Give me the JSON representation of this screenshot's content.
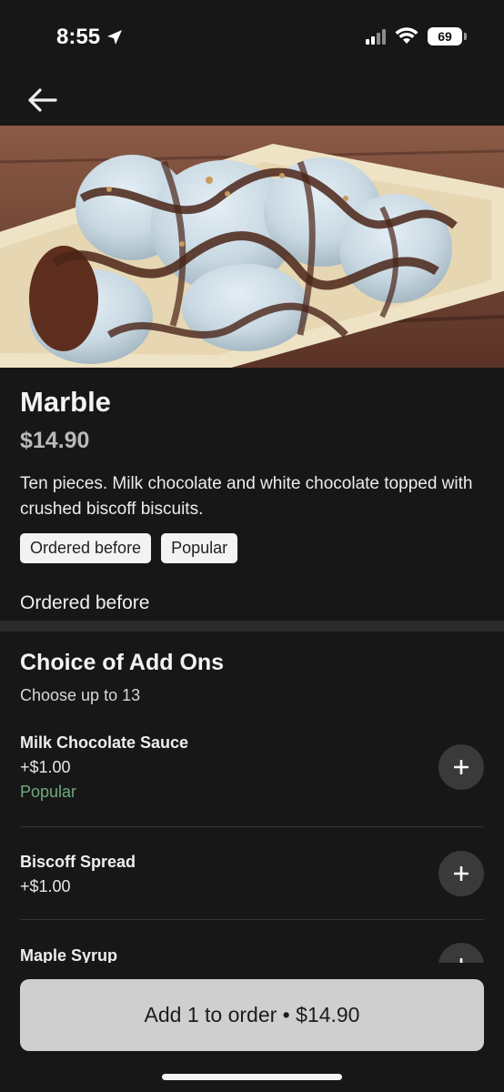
{
  "status_bar": {
    "time": "8:55",
    "battery": "69",
    "location_icon": "location-arrow-icon",
    "wifi_icon": "wifi-icon",
    "signal_icon": "cellular-signal-icon"
  },
  "header": {
    "back_icon": "back-arrow-icon"
  },
  "item": {
    "image_alt": "Marble dessert photo",
    "title": "Marble",
    "price": "$14.90",
    "description": "Ten pieces. Milk chocolate and white chocolate topped with crushed biscoff biscuits.",
    "tags": [
      "Ordered before",
      "Popular"
    ],
    "ordered_note": "Ordered before"
  },
  "addons": {
    "title": "Choice of Add Ons",
    "subtitle": "Choose up to 13",
    "items": [
      {
        "name": "Milk Chocolate Sauce",
        "price": "+$1.00",
        "badge": "Popular"
      },
      {
        "name": "Biscoff Spread",
        "price": "+$1.00",
        "badge": ""
      },
      {
        "name": "Maple Syrup",
        "price": "",
        "badge": ""
      }
    ]
  },
  "action": {
    "order_label": "Add 1 to order • $14.90"
  },
  "colors": {
    "background": "#171717",
    "popular": "#6fa97c",
    "button": "#cfcfcf"
  }
}
